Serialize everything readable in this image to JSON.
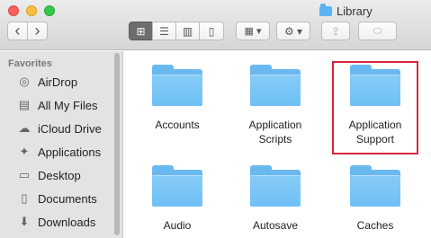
{
  "window": {
    "title": "Library"
  },
  "toolbar": {
    "back_glyph": "‹",
    "forward_glyph": "›",
    "view_icon_glyph": "⊞",
    "view_list_glyph": "☰",
    "view_column_glyph": "▥",
    "view_cover_glyph": "▯",
    "arrange_glyph": "▦ ▾",
    "action_glyph": "⚙ ▾",
    "share_glyph": "⇪",
    "tag_glyph": "⬭"
  },
  "sidebar": {
    "heading": "Favorites",
    "items": [
      {
        "label": "AirDrop",
        "icon": "airdrop-icon",
        "glyph": "◎"
      },
      {
        "label": "All My Files",
        "icon": "all-files-icon",
        "glyph": "▤"
      },
      {
        "label": "iCloud Drive",
        "icon": "cloud-icon",
        "glyph": "☁"
      },
      {
        "label": "Applications",
        "icon": "applications-icon",
        "glyph": "✦"
      },
      {
        "label": "Desktop",
        "icon": "desktop-icon",
        "glyph": "▭"
      },
      {
        "label": "Documents",
        "icon": "documents-icon",
        "glyph": "▯"
      },
      {
        "label": "Downloads",
        "icon": "downloads-icon",
        "glyph": "⬇"
      }
    ]
  },
  "content": {
    "folders": [
      {
        "name": "Accounts"
      },
      {
        "name": "Application Scripts"
      },
      {
        "name": "Application Support"
      },
      {
        "name": "Audio"
      },
      {
        "name": "Autosave"
      },
      {
        "name": "Caches"
      }
    ]
  },
  "colors": {
    "folder": "#6ec0f5",
    "highlight": "#d7263d",
    "active_view": "#6d6d6d"
  }
}
